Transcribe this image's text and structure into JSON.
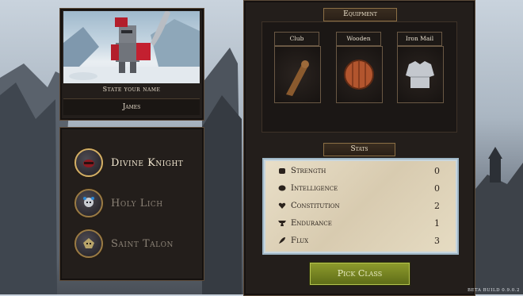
{
  "character": {
    "name_prompt": "State your name",
    "name_value": "James"
  },
  "classes": [
    {
      "label": "Divine Knight",
      "selected": true,
      "icon": "knight-helmet-icon"
    },
    {
      "label": "Holy Lich",
      "selected": false,
      "icon": "lich-skull-icon"
    },
    {
      "label": "Saint Talon",
      "selected": false,
      "icon": "talon-mask-icon"
    }
  ],
  "equipment": {
    "title": "Equipment",
    "items": [
      {
        "label": "Club",
        "icon": "club-icon"
      },
      {
        "label": "Wooden Shield",
        "icon": "wooden-shield-icon"
      },
      {
        "label": "Iron Mail",
        "icon": "iron-mail-icon"
      }
    ]
  },
  "stats": {
    "title": "Stats",
    "rows": [
      {
        "label": "Strength",
        "value": "0",
        "icon": "fist-icon"
      },
      {
        "label": "Intelligence",
        "value": "0",
        "icon": "brain-icon"
      },
      {
        "label": "Constitution",
        "value": "2",
        "icon": "heart-icon"
      },
      {
        "label": "Endurance",
        "value": "1",
        "icon": "anvil-icon"
      },
      {
        "label": "Flux",
        "value": "3",
        "icon": "feather-icon"
      }
    ]
  },
  "actions": {
    "pick_class": "Pick Class"
  },
  "footer": {
    "build": "BETA BUILD 0.9.0.2"
  },
  "colors": {
    "accent_green": "#7b8a23",
    "panel": "#231e1b",
    "parchment": "#e2d7bf"
  }
}
